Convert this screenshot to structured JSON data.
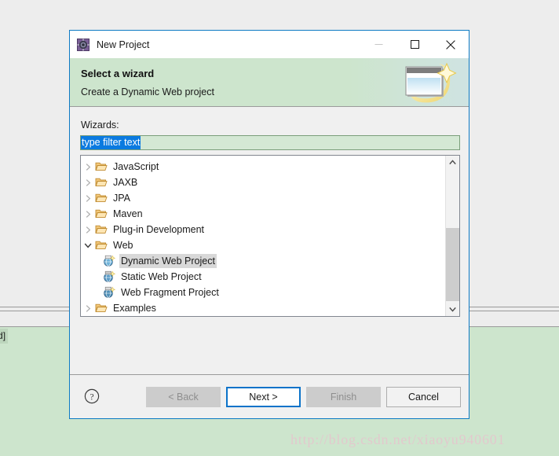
{
  "backdrop": {
    "editor_label": "nized]",
    "watermark": "http://blog.csdn.net/xiaoyu940601",
    "green_color": "#cde5cd",
    "gray_color": "#ededed"
  },
  "dialog": {
    "titlebar": {
      "icon": "eclipse-wizard-icon",
      "title": "New Project",
      "minimize_glyph": "—",
      "maximize_glyph": "□",
      "close_glyph": "✕"
    },
    "banner": {
      "title": "Select a wizard",
      "subtitle": "Create a Dynamic Web project",
      "art": "new-project-banner-icon",
      "background_color": "#cde5cd"
    },
    "wizards_label": "Wizards:",
    "filter": {
      "value": "type filter text",
      "placeholder": "type filter text",
      "selection_color": "#0a7ae0",
      "field_color": "#d4e8d4"
    },
    "tree": {
      "items": [
        {
          "label": "JavaScript",
          "icon": "folder-icon",
          "twisty": "collapsed",
          "level": 0,
          "selected": false
        },
        {
          "label": "JAXB",
          "icon": "folder-icon",
          "twisty": "collapsed",
          "level": 0,
          "selected": false
        },
        {
          "label": "JPA",
          "icon": "folder-icon",
          "twisty": "collapsed",
          "level": 0,
          "selected": false
        },
        {
          "label": "Maven",
          "icon": "folder-icon",
          "twisty": "collapsed",
          "level": 0,
          "selected": false
        },
        {
          "label": "Plug-in Development",
          "icon": "folder-icon",
          "twisty": "collapsed",
          "level": 0,
          "selected": false
        },
        {
          "label": "Web",
          "icon": "folder-icon",
          "twisty": "expanded",
          "level": 0,
          "selected": false
        },
        {
          "label": "Dynamic Web Project",
          "icon": "dynamic-web-project-icon",
          "twisty": "none",
          "level": 1,
          "selected": true
        },
        {
          "label": "Static Web Project",
          "icon": "static-web-project-icon",
          "twisty": "none",
          "level": 1,
          "selected": false
        },
        {
          "label": "Web Fragment Project",
          "icon": "web-fragment-project-icon",
          "twisty": "none",
          "level": 1,
          "selected": false
        },
        {
          "label": "Examples",
          "icon": "folder-icon",
          "twisty": "collapsed",
          "level": 0,
          "selected": false
        }
      ],
      "scrollbar": {
        "up_glyph": "⌃",
        "down_glyph": "⌄"
      }
    },
    "footer": {
      "help": "?",
      "buttons": [
        {
          "label": "< Back",
          "state": "disabled"
        },
        {
          "label": "Next >",
          "state": "default"
        },
        {
          "label": "Finish",
          "state": "disabled"
        },
        {
          "label": "Cancel",
          "state": "normal"
        }
      ]
    }
  }
}
